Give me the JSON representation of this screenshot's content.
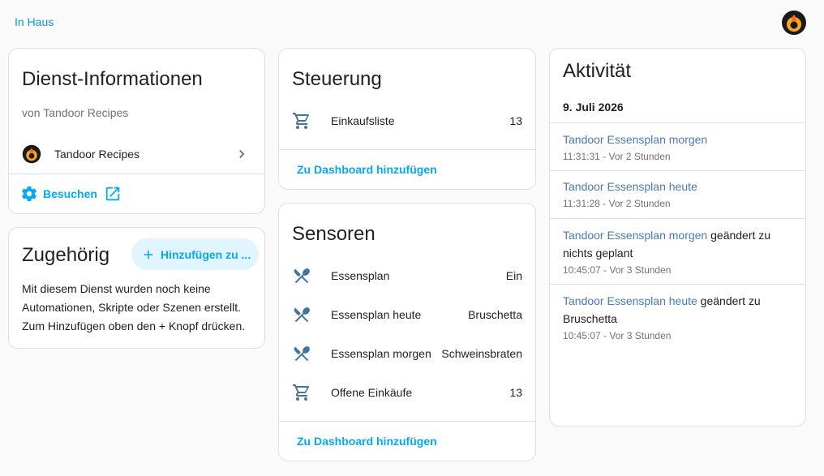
{
  "breadcrumb": {
    "label": "In Haus"
  },
  "service_info": {
    "title": "Dienst-Informationen",
    "subtitle": "von Tandoor Recipes",
    "device_name": "Tandoor Recipes",
    "visit_label": "Besuchen"
  },
  "related": {
    "title": "Zugehörig",
    "add_label": "Hinzufügen zu ...",
    "body": "Mit diesem Dienst wurden noch keine Automationen, Skripte oder Szenen erstellt. Zum Hinzufügen oben den + Knopf drücken."
  },
  "controls": {
    "title": "Steuerung",
    "items": [
      {
        "icon": "cart-icon",
        "label": "Einkaufsliste",
        "value": "13"
      }
    ],
    "add_dashboard_label": "Zu Dashboard hinzufügen"
  },
  "sensors": {
    "title": "Sensoren",
    "items": [
      {
        "icon": "silverware-icon",
        "label": "Essensplan",
        "value": "Ein"
      },
      {
        "icon": "silverware-icon",
        "label": "Essensplan heute",
        "value": "Bruschetta"
      },
      {
        "icon": "silverware-icon",
        "label": "Essensplan morgen",
        "value": "Schweinsbraten"
      },
      {
        "icon": "cart-icon",
        "label": "Offene Einkäufe",
        "value": "13"
      }
    ],
    "add_dashboard_label": "Zu Dashboard hinzufügen"
  },
  "activity": {
    "title": "Aktivität",
    "date": "9. Juli 2026",
    "entries": [
      {
        "entity": "Tandoor Essensplan morgen",
        "rest_line1": "",
        "rest_line2": "",
        "time": "11:31:31 - Vor 2 Stunden"
      },
      {
        "entity": "Tandoor Essensplan heute",
        "rest_line1": "",
        "rest_line2": "",
        "time": "11:31:28 - Vor 2 Stunden"
      },
      {
        "entity": "Tandoor Essensplan morgen",
        "rest_line1": " geändert zu",
        "rest_line2": "nichts geplant",
        "time": "10:45:07 - Vor 3 Stunden"
      },
      {
        "entity": "Tandoor Essensplan heute",
        "rest_line1": " geändert zu",
        "rest_line2": "Bruschetta",
        "time": "10:45:07 - Vor 3 Stunden"
      }
    ]
  },
  "colors": {
    "accent": "#03a9f4",
    "icon": "#44739e",
    "link": "#4a7bb5",
    "divider": "#e0e0e0"
  }
}
